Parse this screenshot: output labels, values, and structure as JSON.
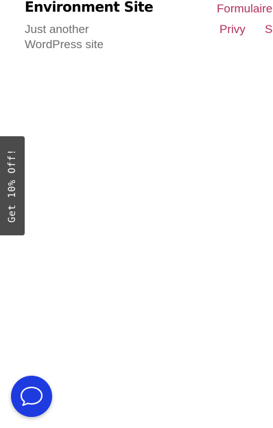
{
  "header": {
    "site_title": "Environment Site",
    "tagline": "Just another WordPress site"
  },
  "nav": {
    "items": [
      {
        "label": "Formulaire"
      },
      {
        "label": "Privy"
      },
      {
        "label": "S"
      }
    ]
  },
  "promo_tab": {
    "label": "Get 10% Off!"
  },
  "chat_button": {
    "icon": "chat-bubble-icon"
  },
  "colors": {
    "nav_link": "#b0305d",
    "tagline": "#6d6d6d",
    "promo_bg": "#4b4b4b",
    "chat_bg": "#1e3be0"
  }
}
